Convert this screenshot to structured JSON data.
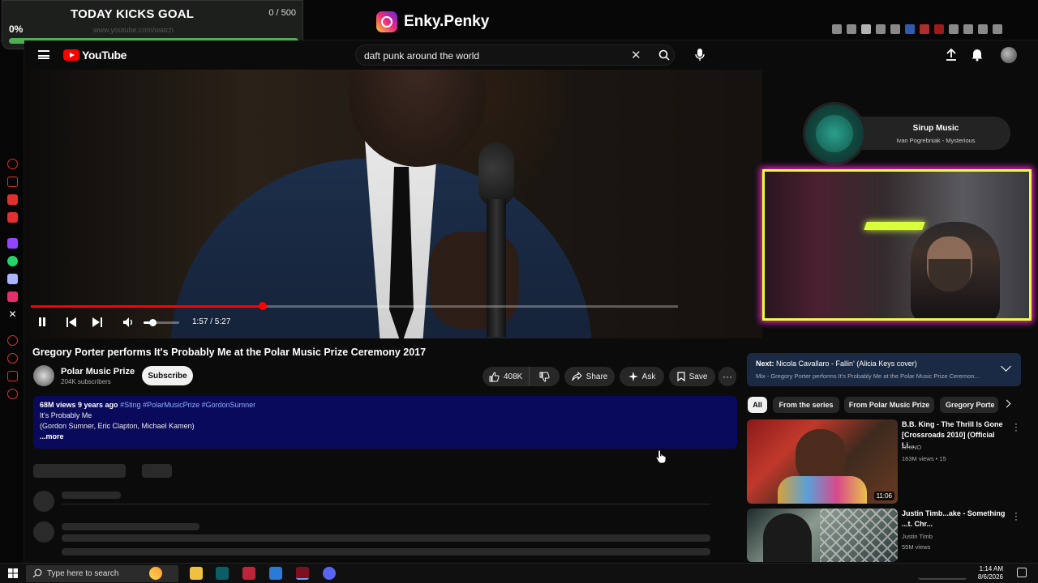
{
  "goal": {
    "title": "TODAY KICKS GOAL",
    "count": "0 / 500",
    "percent": "0%",
    "fill_fraction": 1.0,
    "url": "www.youtube.com/watch"
  },
  "streamer": {
    "name": "Enky.Penky"
  },
  "youtube": {
    "wordmark": "YouTube",
    "search": {
      "value": "daft punk around the world",
      "placeholder": "Search"
    }
  },
  "player": {
    "time": "1:57 / 5:27",
    "progress_fraction": 0.3578,
    "volume_fraction": 0.25
  },
  "now_playing": {
    "title": "Sirup Music",
    "artist": "Ivan Pogrebniak - Mysterious"
  },
  "video": {
    "title": "Gregory Porter performs It's Probably Me at the Polar Music Prize Ceremony 2017",
    "channel": "Polar Music Prize",
    "subscribers": "204K subscribers",
    "subscribe_label": "Subscribe",
    "likes": "408K",
    "share_label": "Share",
    "ask_label": "Ask",
    "save_label": "Save"
  },
  "description": {
    "meta": "68M views  9 years ago",
    "hashtags": "#Sting #PolarMusicPrize #GordonSumner",
    "line1": "It's Probably Me",
    "line2": "(Gordon Sumner, Eric Clapton, Michael Kamen)",
    "more": "...more"
  },
  "sidebar": {
    "next_prefix": "Next:",
    "next_title": "Nicola Cavallaro - Fallin' (Alicia Keys cover)",
    "next_sub": "Mix - Gregory Porter performs It's Probably Me at the Polar Music Prize Ceremon...",
    "chips": [
      "All",
      "From the series",
      "From Polar Music Prize",
      "Gregory Porte"
    ],
    "recommendations": [
      {
        "title": "B.B. King - The Thrill Is Gone [Crossroads 2010] (Official Li...",
        "channel": "RHINO",
        "meta": "163M views • 15",
        "duration": "11:06"
      },
      {
        "title": "Justin Timb...ake - Something ...t. Chr...",
        "channel": "Justin Timb",
        "meta": "55M views"
      }
    ]
  },
  "taskbar": {
    "search_placeholder": "Type here to search",
    "time": "1:14 AM",
    "date": "8/6/2026"
  },
  "colors": {
    "accent": "#ff0000",
    "goal_bar": "#4caf50",
    "webcam_border": "#e8ff3a",
    "webcam_glow": "#ff2bd6",
    "description_bg": "#0a0a5c",
    "next_card_bg": "#1b2a44"
  }
}
